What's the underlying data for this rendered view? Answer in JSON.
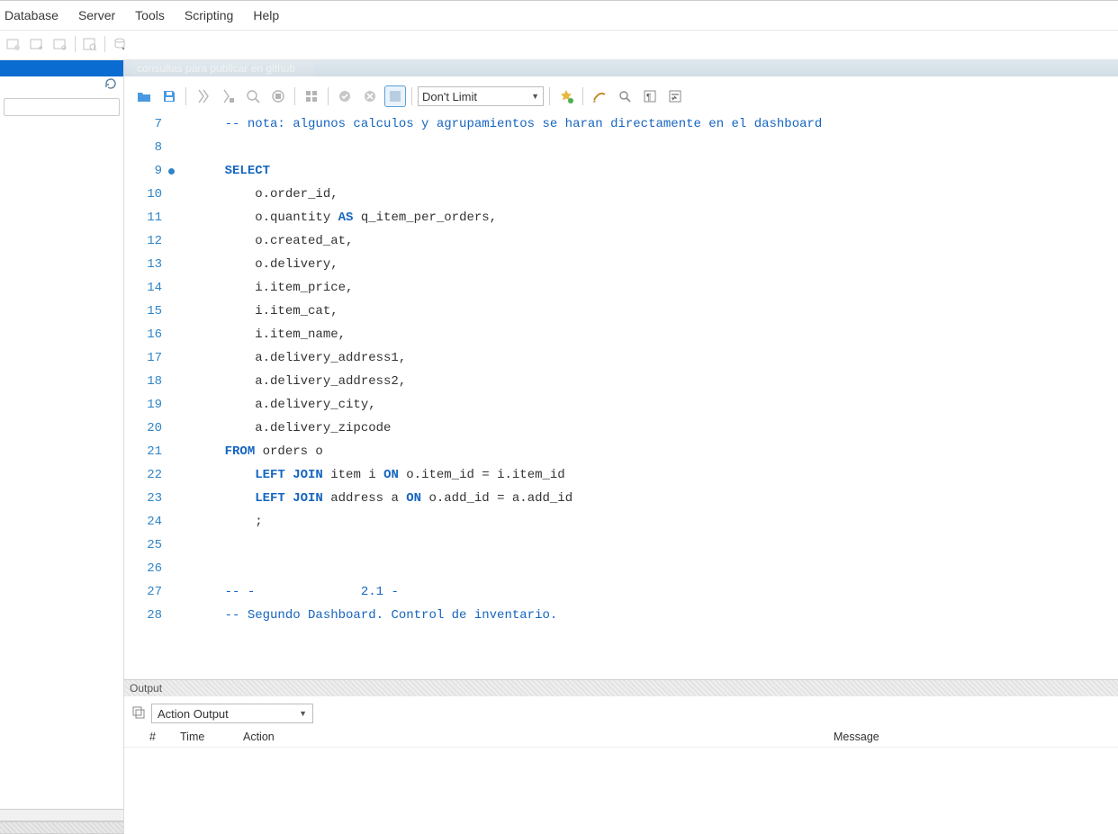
{
  "menu": {
    "database": "Database",
    "server": "Server",
    "tools": "Tools",
    "scripting": "Scripting",
    "help": "Help"
  },
  "tab": {
    "title": "consultas para publicar en github"
  },
  "query_toolbar": {
    "limit": "Don't Limit"
  },
  "editor": {
    "lines": [
      {
        "n": 7,
        "dot": false,
        "segments": [
          {
            "t": "    ",
            "c": ""
          },
          {
            "t": "-- nota: algunos calculos y agrupamientos se haran directamente en el dashboard",
            "c": "cm"
          }
        ]
      },
      {
        "n": 8,
        "dot": false,
        "segments": [
          {
            "t": "",
            "c": ""
          }
        ]
      },
      {
        "n": 9,
        "dot": true,
        "segments": [
          {
            "t": "    ",
            "c": ""
          },
          {
            "t": "SELECT",
            "c": "kw"
          }
        ]
      },
      {
        "n": 10,
        "dot": false,
        "segments": [
          {
            "t": "        o.order_id,",
            "c": ""
          }
        ]
      },
      {
        "n": 11,
        "dot": false,
        "segments": [
          {
            "t": "        o.quantity ",
            "c": ""
          },
          {
            "t": "AS",
            "c": "kw"
          },
          {
            "t": " q_item_per_orders,",
            "c": ""
          }
        ]
      },
      {
        "n": 12,
        "dot": false,
        "segments": [
          {
            "t": "        o.created_at,",
            "c": ""
          }
        ]
      },
      {
        "n": 13,
        "dot": false,
        "segments": [
          {
            "t": "        o.delivery,",
            "c": ""
          }
        ]
      },
      {
        "n": 14,
        "dot": false,
        "segments": [
          {
            "t": "        i.item_price,",
            "c": ""
          }
        ]
      },
      {
        "n": 15,
        "dot": false,
        "segments": [
          {
            "t": "        i.item_cat,",
            "c": ""
          }
        ]
      },
      {
        "n": 16,
        "dot": false,
        "segments": [
          {
            "t": "        i.item_name,",
            "c": ""
          }
        ]
      },
      {
        "n": 17,
        "dot": false,
        "segments": [
          {
            "t": "        a.delivery_address1,",
            "c": ""
          }
        ]
      },
      {
        "n": 18,
        "dot": false,
        "segments": [
          {
            "t": "        a.delivery_address2,",
            "c": ""
          }
        ]
      },
      {
        "n": 19,
        "dot": false,
        "segments": [
          {
            "t": "        a.delivery_city,",
            "c": ""
          }
        ]
      },
      {
        "n": 20,
        "dot": false,
        "segments": [
          {
            "t": "        a.delivery_zipcode",
            "c": ""
          }
        ]
      },
      {
        "n": 21,
        "dot": false,
        "segments": [
          {
            "t": "    ",
            "c": ""
          },
          {
            "t": "FROM",
            "c": "kw"
          },
          {
            "t": " orders o",
            "c": ""
          }
        ]
      },
      {
        "n": 22,
        "dot": false,
        "segments": [
          {
            "t": "        ",
            "c": ""
          },
          {
            "t": "LEFT JOIN",
            "c": "kw"
          },
          {
            "t": " item i ",
            "c": ""
          },
          {
            "t": "ON",
            "c": "kw"
          },
          {
            "t": " o.item_id = i.item_id",
            "c": ""
          }
        ]
      },
      {
        "n": 23,
        "dot": false,
        "segments": [
          {
            "t": "        ",
            "c": ""
          },
          {
            "t": "LEFT JOIN",
            "c": "kw"
          },
          {
            "t": " address a ",
            "c": ""
          },
          {
            "t": "ON",
            "c": "kw"
          },
          {
            "t": " o.add_id = a.add_id",
            "c": ""
          }
        ]
      },
      {
        "n": 24,
        "dot": false,
        "segments": [
          {
            "t": "        ;",
            "c": ""
          }
        ]
      },
      {
        "n": 25,
        "dot": false,
        "segments": [
          {
            "t": " ",
            "c": ""
          }
        ]
      },
      {
        "n": 26,
        "dot": false,
        "segments": [
          {
            "t": " ",
            "c": ""
          }
        ]
      },
      {
        "n": 27,
        "dot": false,
        "segments": [
          {
            "t": "    ",
            "c": ""
          },
          {
            "t": "-- -              2.1 -",
            "c": "cm"
          }
        ]
      },
      {
        "n": 28,
        "dot": false,
        "segments": [
          {
            "t": "    ",
            "c": ""
          },
          {
            "t": "-- Segundo Dashboard. Control de inventario.",
            "c": "cm"
          }
        ]
      }
    ]
  },
  "output": {
    "title": "Output",
    "select": "Action Output",
    "columns": {
      "hash": "#",
      "time": "Time",
      "action": "Action",
      "message": "Message"
    }
  }
}
